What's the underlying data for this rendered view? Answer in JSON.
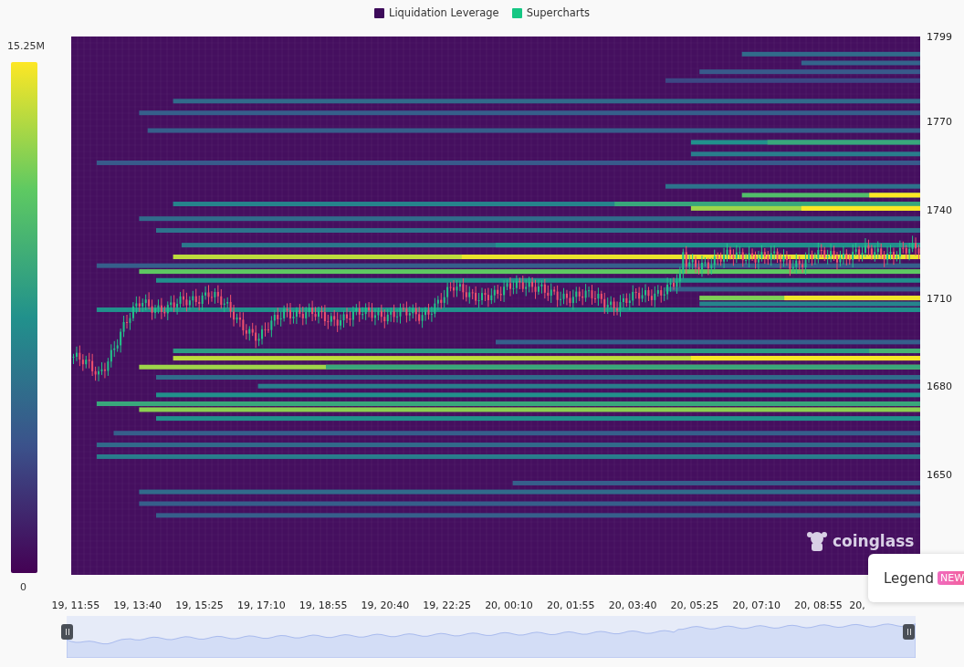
{
  "legend": [
    {
      "label": "Liquidation Leverage",
      "color": "#3d0b5a"
    },
    {
      "label": "Supercharts",
      "color": "#16c784"
    }
  ],
  "colorbar": {
    "max_label": "15.25M",
    "min_label": "0"
  },
  "y_axis": {
    "ticks": [
      "1799",
      "1770",
      "1740",
      "1710",
      "1680",
      "1650"
    ]
  },
  "x_axis": {
    "labels": [
      "19, 11:55",
      "19, 13:40",
      "19, 15:25",
      "19, 17:10",
      "19, 18:55",
      "19, 20:40",
      "19, 22:25",
      "20, 00:10",
      "20, 01:55",
      "20, 03:40",
      "20, 05:25",
      "20, 07:10",
      "20, 08:55",
      "20,"
    ]
  },
  "brand_logo": {
    "text": "coinglass"
  },
  "legend_panel": {
    "label": "Legend",
    "badge": "NEW"
  }
}
